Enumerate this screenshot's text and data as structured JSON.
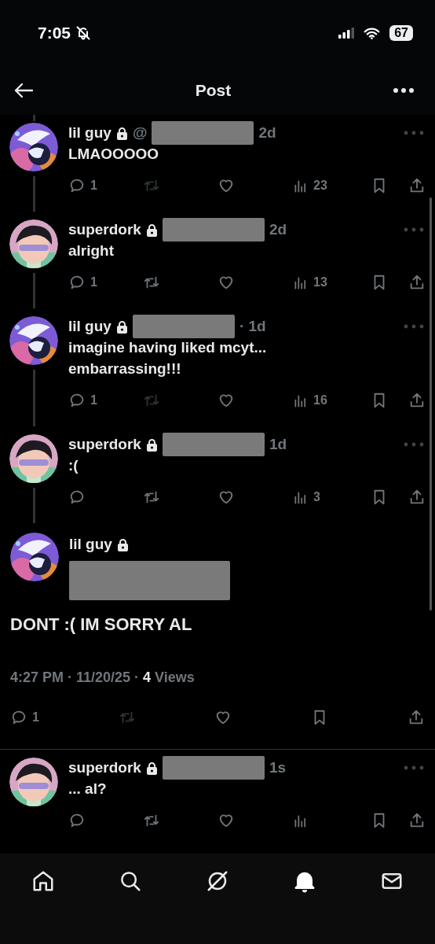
{
  "status_bar": {
    "time": "7:05",
    "silent": true,
    "battery": "67"
  },
  "header": {
    "title": "Post"
  },
  "replies": [
    {
      "name": "lil guy",
      "kind": "creature",
      "locked": true,
      "handle": "@",
      "handle_redacted": true,
      "time": "2d",
      "text": "LMAOOOOO",
      "retweet_disabled": true,
      "stats": {
        "replies": "1",
        "views": "23"
      },
      "thread_above": true,
      "thread_below": true
    },
    {
      "name": "superdork",
      "kind": "cartoon",
      "locked": true,
      "handle_redacted": true,
      "time": "2d",
      "text": "alright",
      "retweet_disabled": false,
      "stats": {
        "replies": "1",
        "views": "13"
      },
      "thread_below": true
    },
    {
      "name": "lil guy",
      "kind": "creature",
      "locked": true,
      "handle_redacted": true,
      "time": "· 1d",
      "text": "imagine having liked mcyt... embarrassing!!!",
      "retweet_disabled": true,
      "stats": {
        "replies": "1",
        "views": "16"
      },
      "thread_below": true
    },
    {
      "name": "superdork",
      "kind": "cartoon",
      "locked": true,
      "handle_redacted": true,
      "time": "1d",
      "text": ":(",
      "retweet_disabled": false,
      "stats": {
        "views": "3"
      },
      "thread_below": true
    }
  ],
  "main_post": {
    "name": "lil guy",
    "kind": "creature",
    "locked": true,
    "handle_redacted": true,
    "text": "DONT :( IM SORRY AL",
    "timestamp": "4:27 PM · 11/20/25 ·",
    "views_count": "4",
    "views_label": "Views",
    "retweet_disabled": true,
    "stats": {
      "replies": "1"
    }
  },
  "after": [
    {
      "name": "superdork",
      "kind": "cartoon",
      "locked": true,
      "handle_redacted": true,
      "time": "1s",
      "text": "... al?",
      "retweet_disabled": false
    }
  ],
  "tab_bar": [
    {
      "selected": false
    },
    {
      "selected": false
    },
    {
      "selected": false
    },
    {
      "selected": true
    },
    {
      "selected": false
    }
  ]
}
